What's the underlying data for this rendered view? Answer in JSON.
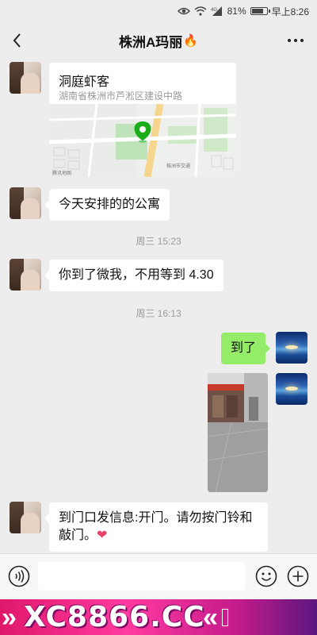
{
  "status_bar": {
    "battery": "81%",
    "time": "早上8:26",
    "battery_level": 0.81,
    "network": "4G"
  },
  "header": {
    "title": "株洲A玛丽",
    "title_emoji": "🔥"
  },
  "messages": {
    "location": {
      "name": "洞庭虾客",
      "address": "湖南省株洲市芦淞区建设中路"
    },
    "msg1": "今天安排的的公寓",
    "time1": "周三 15:23",
    "msg2": "你到了微我，不用等到 4.30",
    "time2": "周三 16:13",
    "msg_me": "到了",
    "msg3": "到门口发信息:开门。请勿按门铃和敲门。",
    "msg3_emoji": "❤"
  },
  "map_labels": {
    "watermark": "腾讯地图",
    "poi": "株洲市交通"
  },
  "ad": {
    "brand": "XC8866.CC",
    "colors": [
      "#e0186b",
      "#ff3aa0",
      "#5b1780"
    ]
  },
  "icons": [
    "back-arrow-icon",
    "more-icon",
    "voice-icon",
    "emoji-icon",
    "plus-icon",
    "location-pin-icon",
    "wifi-icon",
    "signal-icon",
    "eye-icon",
    "battery-icon"
  ]
}
